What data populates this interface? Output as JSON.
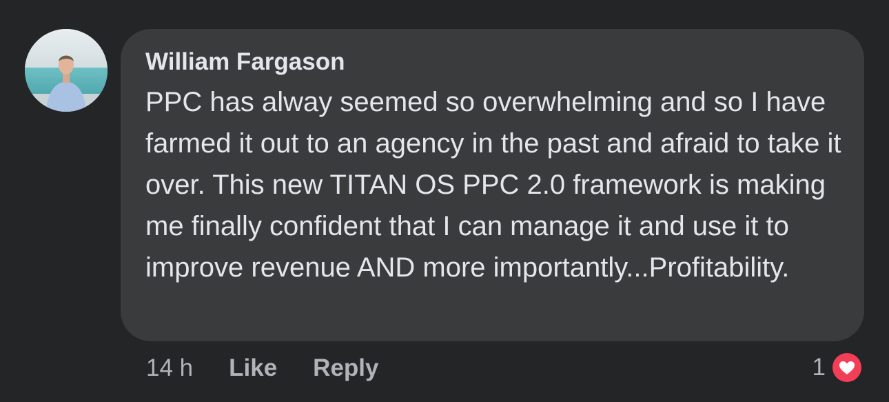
{
  "comment": {
    "author": "William Fargason",
    "text": "PPC has alway seemed so overwhelming and so I have farmed it out to an agency in the past and afraid to take it over. This new TITAN OS PPC 2.0 framework is making me finally confident that I can manage it and use it to improve revenue AND more importantly...Profitability.",
    "time": "14 h",
    "like_label": "Like",
    "reply_label": "Reply",
    "reaction_count": "1",
    "reaction_icon": "heart-icon"
  },
  "colors": {
    "background": "#242526",
    "bubble": "#3a3b3c",
    "primary_text": "#e4e6eb",
    "secondary_text": "#b0b3b8",
    "love_reaction": "#f33e58"
  }
}
